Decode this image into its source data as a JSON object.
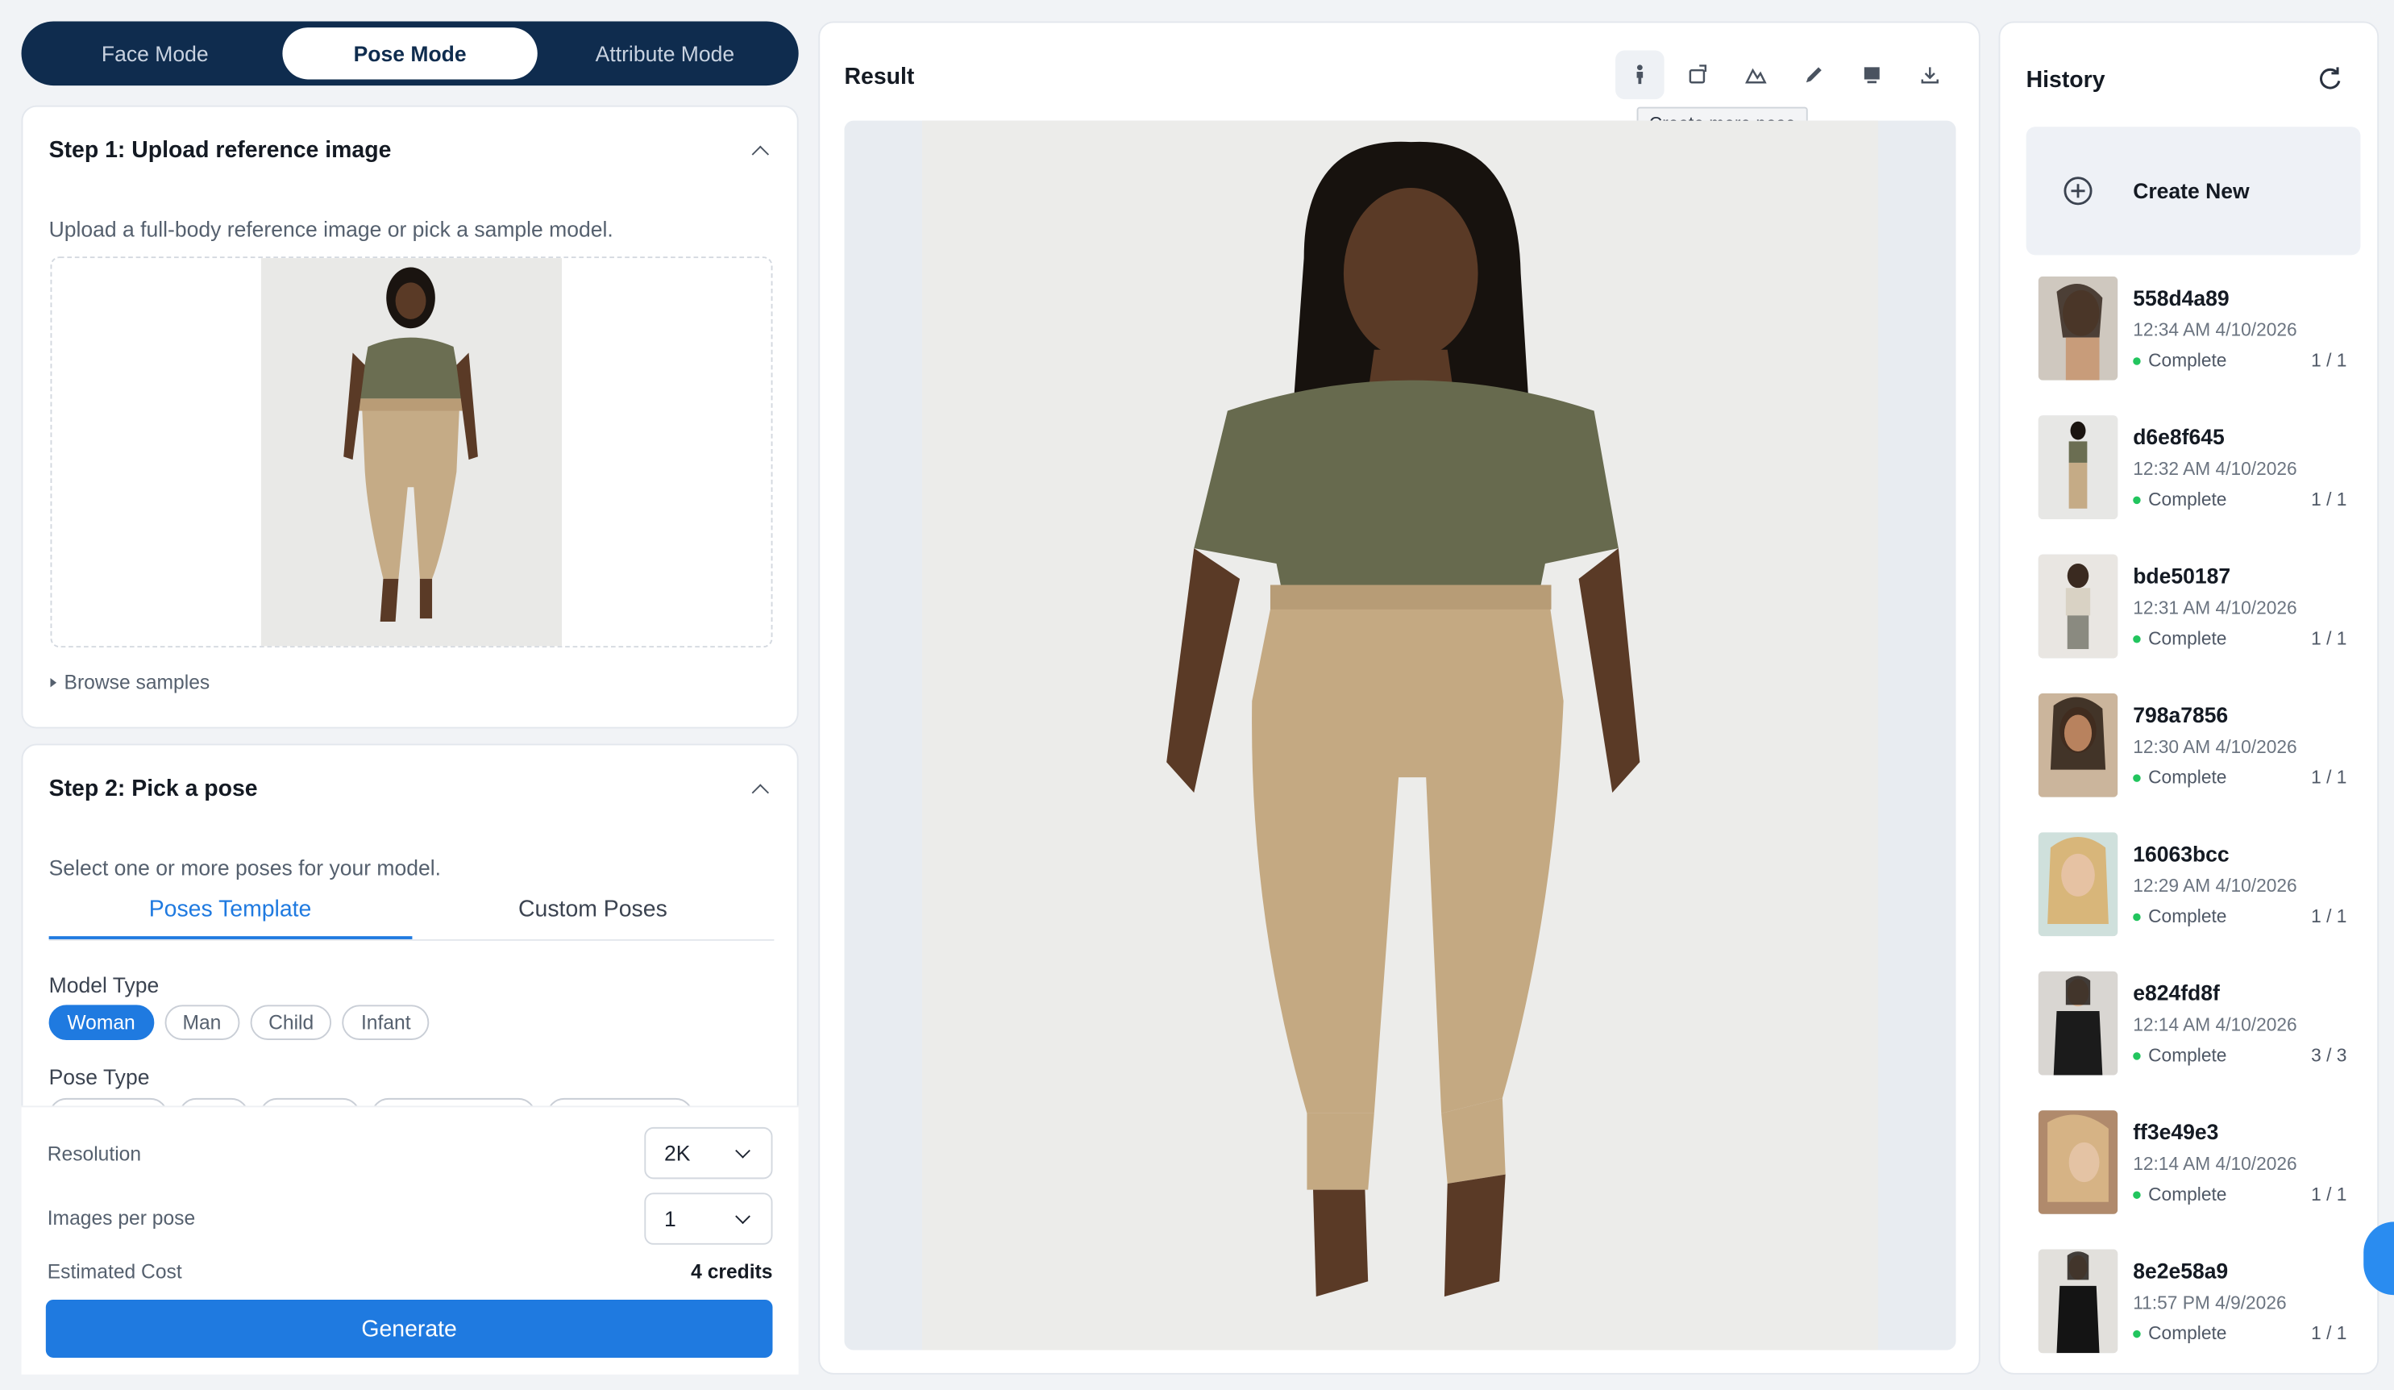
{
  "modes": [
    "Face Mode",
    "Pose Mode",
    "Attribute Mode"
  ],
  "active_mode": "Pose Mode",
  "step1": {
    "title": "Step 1: Upload reference image",
    "description": "Upload a full-body reference image or pick a sample model.",
    "browse": "Browse samples"
  },
  "step2": {
    "title": "Step 2: Pick a pose",
    "description": "Select one or more poses for your model.",
    "tabs": [
      "Poses Template",
      "Custom Poses"
    ],
    "model_type_label": "Model Type",
    "model_types": [
      "Woman",
      "Man",
      "Child",
      "Infant"
    ],
    "pose_type_label": "Pose Type"
  },
  "settings": {
    "resolution_label": "Resolution",
    "resolution_value": "2K",
    "images_per_pose_label": "Images per pose",
    "images_per_pose_value": "1",
    "cost_label": "Estimated Cost",
    "cost_value": "4 credits",
    "generate": "Generate"
  },
  "result": {
    "title": "Result",
    "tooltip": "Create more pose",
    "tools": [
      "pose-figure-icon",
      "rotate-icon",
      "mountain-icon",
      "pencil-icon",
      "image-edit-icon",
      "download-icon"
    ]
  },
  "history": {
    "title": "History",
    "create_new": "Create New",
    "items": [
      {
        "id": "558d4a89",
        "time": "12:34 AM 4/10/2026",
        "status": "Complete",
        "count": "1 / 1"
      },
      {
        "id": "d6e8f645",
        "time": "12:32 AM 4/10/2026",
        "status": "Complete",
        "count": "1 / 1"
      },
      {
        "id": "bde50187",
        "time": "12:31 AM 4/10/2026",
        "status": "Complete",
        "count": "1 / 1"
      },
      {
        "id": "798a7856",
        "time": "12:30 AM 4/10/2026",
        "status": "Complete",
        "count": "1 / 1"
      },
      {
        "id": "16063bcc",
        "time": "12:29 AM 4/10/2026",
        "status": "Complete",
        "count": "1 / 1"
      },
      {
        "id": "e824fd8f",
        "time": "12:14 AM 4/10/2026",
        "status": "Complete",
        "count": "3 / 3"
      },
      {
        "id": "ff3e49e3",
        "time": "12:14 AM 4/10/2026",
        "status": "Complete",
        "count": "1 / 1"
      },
      {
        "id": "8e2e58a9",
        "time": "11:57 PM 4/9/2026",
        "status": "Complete",
        "count": "1 / 1"
      }
    ]
  },
  "colors": {
    "accent": "#1f7ae0",
    "nav": "#0f2c4e",
    "status_ok": "#22c55e"
  }
}
